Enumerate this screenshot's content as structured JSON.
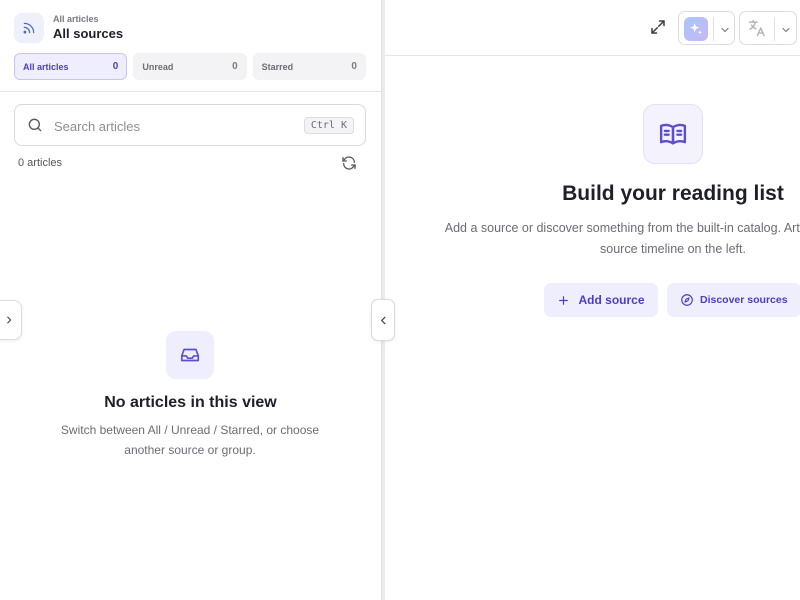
{
  "sidebar": {
    "source_subtitle": "All articles",
    "source_title": "All sources",
    "filters": [
      {
        "label": "All articles",
        "count": "0",
        "active": true
      },
      {
        "label": "Unread",
        "count": "0",
        "active": false
      },
      {
        "label": "Starred",
        "count": "0",
        "active": false
      }
    ],
    "search": {
      "placeholder": "Search articles",
      "shortcut": "Ctrl K"
    },
    "article_count": "0 articles",
    "empty": {
      "title": "No articles in this view",
      "description": "Switch between All / Unread / Starred, or choose another source or group."
    }
  },
  "main": {
    "title": "Build your reading list",
    "description": "Add a source or discover something from the built-in catalog. Articles appear in the\nsource timeline on the left.",
    "add_source_label": "Add source",
    "discover_label": "Discover sources"
  },
  "icons": {
    "source": "rss-icon",
    "search": "search-icon",
    "refresh": "refresh-icon",
    "empty": "inbox-icon",
    "hero": "book-open-icon",
    "expand": "expand-icon",
    "ai": "sparkles-icon",
    "translate": "translate-icon",
    "add": "plus-icon",
    "discover": "compass-icon"
  },
  "colors": {
    "accent": "#4a3fc2",
    "accent_soft": "#efeefe"
  }
}
